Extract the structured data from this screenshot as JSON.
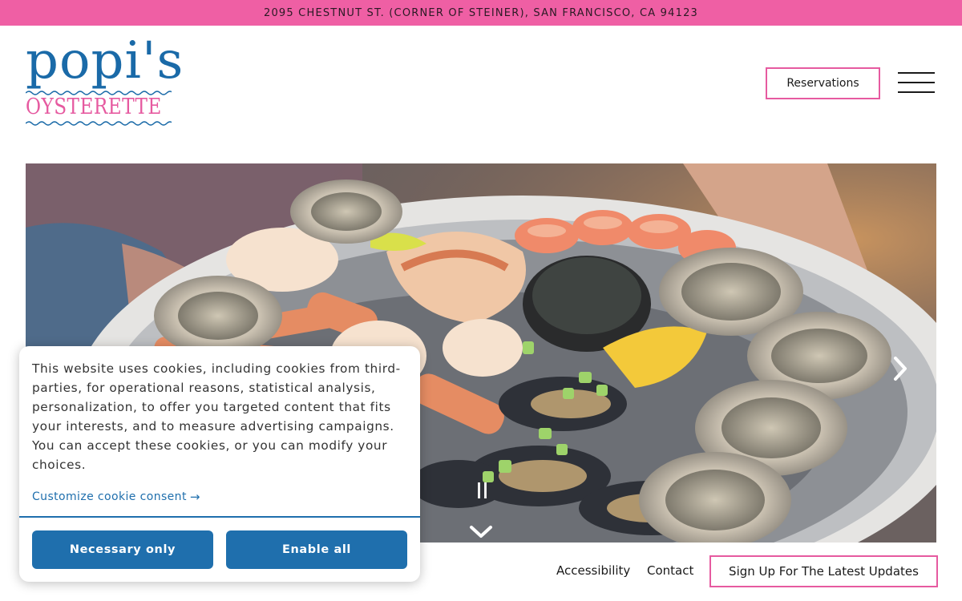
{
  "topbar": {
    "address": "2095 CHESTNUT ST. (CORNER OF STEINER), SAN FRANCISCO, CA 94123",
    "background": "#ef5fa4"
  },
  "logo": {
    "name": "popi's",
    "sub": "OYSTERETTE",
    "primary_color": "#1a6aa8",
    "accent_color": "#e65aa0"
  },
  "header": {
    "reservations_label": "Reservations",
    "menu_icon": "hamburger-icon"
  },
  "hero": {
    "image_subject": "platter of oysters, crab, shrimp, mussels and lemon",
    "next_icon": "chevron-right-icon",
    "pause_icon": "pause-icon",
    "scroll_icon": "chevron-down-icon"
  },
  "footer": {
    "links": [
      "Accessibility",
      "Contact"
    ],
    "signup_label": "Sign Up For The Latest Updates"
  },
  "cookie_banner": {
    "message": "This website uses cookies, including cookies from third-parties, for operational reasons, statistical analysis, personalization, to offer you targeted content that fits your interests, and to measure advertising campaigns. You can accept these cookies, or you can modify your choices.",
    "customize_label": "Customize cookie consent",
    "customize_icon": "arrow-right-icon",
    "necessary_label": "Necessary only",
    "enable_label": "Enable all",
    "button_color": "#1f6fad"
  }
}
